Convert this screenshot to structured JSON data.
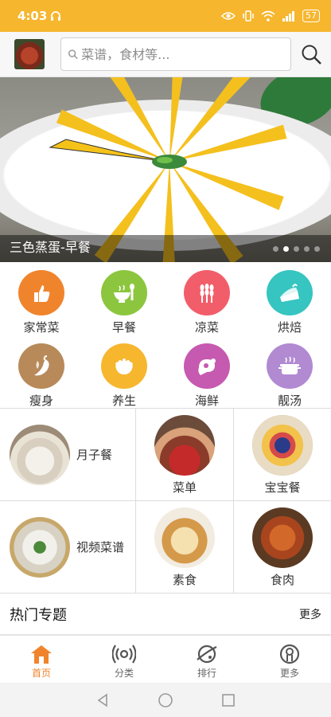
{
  "status_bar": {
    "time": "4:03",
    "battery": "57"
  },
  "search": {
    "placeholder": "菜谱，食材等..."
  },
  "banner": {
    "caption": "三色蒸蛋-早餐",
    "slide_count": 5,
    "active_slide": 2
  },
  "categories": [
    {
      "label": "家常菜",
      "icon": "thumbs-up-icon",
      "color": "#f0842c"
    },
    {
      "label": "早餐",
      "icon": "bowl-icon",
      "color": "#8cc63f"
    },
    {
      "label": "凉菜",
      "icon": "wheat-icon",
      "color": "#f25d6a"
    },
    {
      "label": "烘焙",
      "icon": "cake-icon",
      "color": "#36c5c0"
    },
    {
      "label": "瘦身",
      "icon": "chili-icon",
      "color": "#b88a5a"
    },
    {
      "label": "养生",
      "icon": "food-bowl-icon",
      "color": "#f6b62e"
    },
    {
      "label": "海鲜",
      "icon": "ham-icon",
      "color": "#c659b0"
    },
    {
      "label": "靓汤",
      "icon": "soup-pot-icon",
      "color": "#b18ad2"
    }
  ],
  "features": [
    {
      "label": "月子餐"
    },
    {
      "label": "菜单"
    },
    {
      "label": "宝宝餐"
    },
    {
      "label": "视频菜谱"
    },
    {
      "label": "素食"
    },
    {
      "label": "食肉"
    }
  ],
  "section": {
    "title": "热门专题",
    "more": "更多"
  },
  "bottom_nav": [
    {
      "label": "首页",
      "icon": "home-icon",
      "active": true
    },
    {
      "label": "分类",
      "icon": "broadcast-icon",
      "active": false
    },
    {
      "label": "排行",
      "icon": "planet-icon",
      "active": false
    },
    {
      "label": "更多",
      "icon": "person-icon",
      "active": false
    }
  ],
  "colors": {
    "accent": "#f6b62e",
    "active_tab": "#f0842c"
  }
}
